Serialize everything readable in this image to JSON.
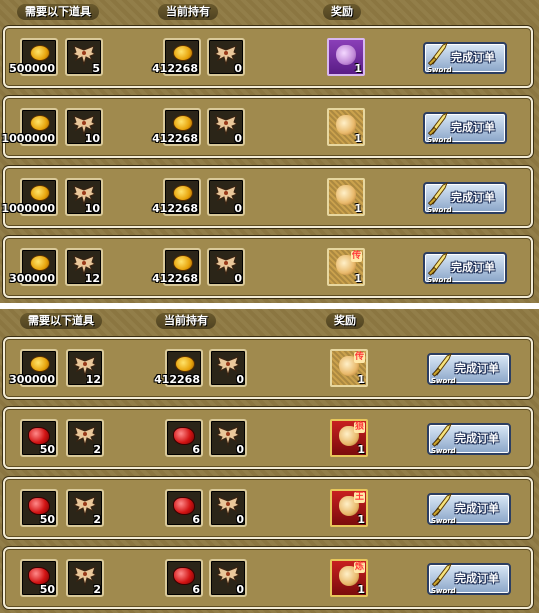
{
  "headers": {
    "required": "需要以下道具",
    "owned": "当前持有",
    "reward": "奖励"
  },
  "button": {
    "label": "完成订单",
    "sub": "Sword"
  },
  "colors": {
    "panel": "#8f7a43",
    "row": "#a08a4e"
  },
  "top_rows": [
    {
      "req_item": "coin",
      "req_amount": "500000",
      "req_wing": "5",
      "own_item": "coin",
      "own_amount": "412268",
      "own_wing": "0",
      "reward_style": "purple",
      "reward_tag": "",
      "reward_count": "1"
    },
    {
      "req_item": "coin",
      "req_amount": "1000000",
      "req_wing": "10",
      "own_item": "coin",
      "own_amount": "412268",
      "own_wing": "0",
      "reward_style": "gold",
      "reward_tag": "",
      "reward_count": "1"
    },
    {
      "req_item": "coin",
      "req_amount": "1000000",
      "req_wing": "10",
      "own_item": "coin",
      "own_amount": "412268",
      "own_wing": "0",
      "reward_style": "gold",
      "reward_tag": "",
      "reward_count": "1"
    },
    {
      "req_item": "coin",
      "req_amount": "300000",
      "req_wing": "12",
      "own_item": "coin",
      "own_amount": "412268",
      "own_wing": "0",
      "reward_style": "gold",
      "reward_tag": "传",
      "reward_count": "1"
    }
  ],
  "bottom_rows": [
    {
      "req_item": "coin",
      "req_amount": "300000",
      "req_wing": "12",
      "own_item": "coin",
      "own_amount": "412268",
      "own_wing": "0",
      "reward_style": "gold",
      "reward_tag": "传",
      "reward_count": "1"
    },
    {
      "req_item": "gem",
      "req_amount": "50",
      "req_wing": "2",
      "own_item": "gem",
      "own_amount": "6",
      "own_wing": "0",
      "reward_style": "red",
      "reward_tag": "狼",
      "reward_count": "1"
    },
    {
      "req_item": "gem",
      "req_amount": "50",
      "req_wing": "2",
      "own_item": "gem",
      "own_amount": "6",
      "own_wing": "0",
      "reward_style": "red",
      "reward_tag": "王",
      "reward_count": "1"
    },
    {
      "req_item": "gem",
      "req_amount": "50",
      "req_wing": "2",
      "own_item": "gem",
      "own_amount": "6",
      "own_wing": "0",
      "reward_style": "red",
      "reward_tag": "炼",
      "reward_count": "1"
    }
  ]
}
